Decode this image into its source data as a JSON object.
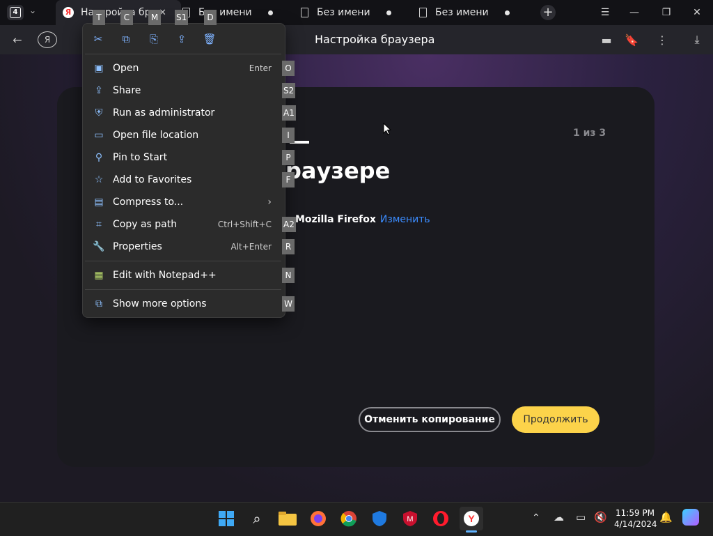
{
  "browser": {
    "tab_count": "4",
    "tabs": [
      {
        "label": "Настройка браузера"
      },
      {
        "label": "Без имени"
      },
      {
        "label": "Без имени"
      },
      {
        "label": "Без имени"
      }
    ],
    "page_title": "Настройка браузера"
  },
  "page": {
    "counter": "1 из 3",
    "heading": "раузере",
    "import_source": "Mozilla Firefox",
    "change_link": "Изменить",
    "cancel_button": "Отменить копирование",
    "continue_button": "Продолжить"
  },
  "context_menu": {
    "top_actions": [
      {
        "icon": "cut-icon",
        "key": "T"
      },
      {
        "icon": "copy-icon",
        "key": "C"
      },
      {
        "icon": "rename-icon",
        "key": "M"
      },
      {
        "icon": "share-icon",
        "key": "S1"
      },
      {
        "icon": "delete-icon",
        "key": "D"
      }
    ],
    "items": [
      {
        "label": "Open",
        "shortcut": "Enter",
        "key": "O",
        "icon": "open-icon"
      },
      {
        "label": "Share",
        "shortcut": "",
        "key": "S2",
        "icon": "share-icon"
      },
      {
        "label": "Run as administrator",
        "shortcut": "",
        "key": "A1",
        "icon": "shield-icon"
      },
      {
        "label": "Open file location",
        "shortcut": "",
        "key": "I",
        "icon": "folder-icon"
      },
      {
        "label": "Pin to Start",
        "shortcut": "",
        "key": "P",
        "icon": "pin-icon"
      },
      {
        "label": "Add to Favorites",
        "shortcut": "",
        "key": "F",
        "icon": "star-icon"
      },
      {
        "label": "Compress to...",
        "shortcut": "",
        "key": "",
        "icon": "archive-icon"
      },
      {
        "label": "Copy as path",
        "shortcut": "Ctrl+Shift+C",
        "key": "A2",
        "icon": "path-icon"
      },
      {
        "label": "Properties",
        "shortcut": "Alt+Enter",
        "key": "R",
        "icon": "wrench-icon"
      },
      {
        "label": "Edit with Notepad++",
        "shortcut": "",
        "key": "N",
        "icon": "notepad-icon"
      },
      {
        "label": "Show more options",
        "shortcut": "",
        "key": "W",
        "icon": "more-options-icon"
      }
    ]
  },
  "taskbar": {
    "time": "11:59 PM",
    "date": "4/14/2024"
  }
}
